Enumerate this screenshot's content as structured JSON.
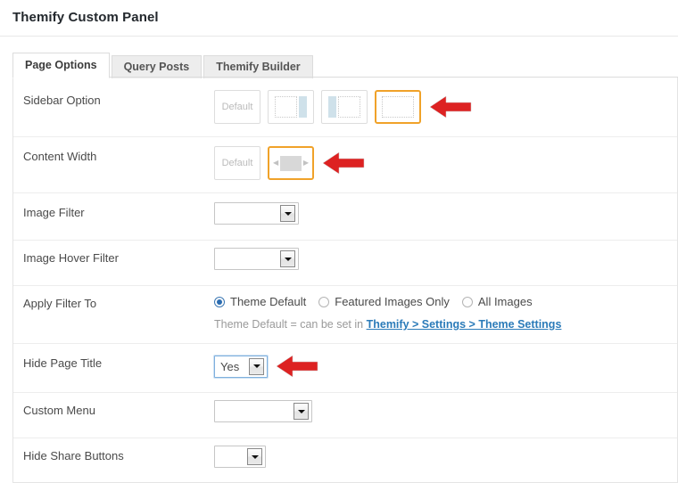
{
  "panel": {
    "title": "Themify Custom Panel"
  },
  "tabs": [
    {
      "label": "Page Options",
      "active": true
    },
    {
      "label": "Query Posts",
      "active": false
    },
    {
      "label": "Themify Builder",
      "active": false
    }
  ],
  "rows": {
    "sidebar_option": {
      "label": "Sidebar Option",
      "default_label": "Default",
      "options": [
        {
          "name": "default",
          "selected": false
        },
        {
          "name": "sidebar-right",
          "selected": false
        },
        {
          "name": "sidebar-left",
          "selected": false
        },
        {
          "name": "no-sidebar",
          "selected": true
        }
      ],
      "annotation": "red-arrow-left"
    },
    "content_width": {
      "label": "Content Width",
      "default_label": "Default",
      "options": [
        {
          "name": "default",
          "selected": false
        },
        {
          "name": "fullwidth",
          "selected": true
        }
      ],
      "annotation": "red-arrow-left"
    },
    "image_filter": {
      "label": "Image Filter",
      "value": "",
      "placeholder": ""
    },
    "image_hover_filter": {
      "label": "Image Hover Filter",
      "value": "",
      "placeholder": ""
    },
    "apply_filter_to": {
      "label": "Apply Filter To",
      "choices": [
        {
          "label": "Theme Default",
          "selected": true
        },
        {
          "label": "Featured Images Only",
          "selected": false
        },
        {
          "label": "All Images",
          "selected": false
        }
      ],
      "hint_prefix": "Theme Default = can be set in ",
      "hint_link": "Themify > Settings > Theme Settings"
    },
    "hide_page_title": {
      "label": "Hide Page Title",
      "value": "Yes",
      "annotation": "red-arrow-left"
    },
    "custom_menu": {
      "label": "Custom Menu",
      "value": ""
    },
    "hide_share_buttons": {
      "label": "Hide Share Buttons",
      "value": ""
    }
  },
  "colors": {
    "selected_border": "#f0a229",
    "arrow_red": "#dd2222",
    "link_blue": "#2b7bb9",
    "sidebar_block": "#cfe1ea"
  }
}
